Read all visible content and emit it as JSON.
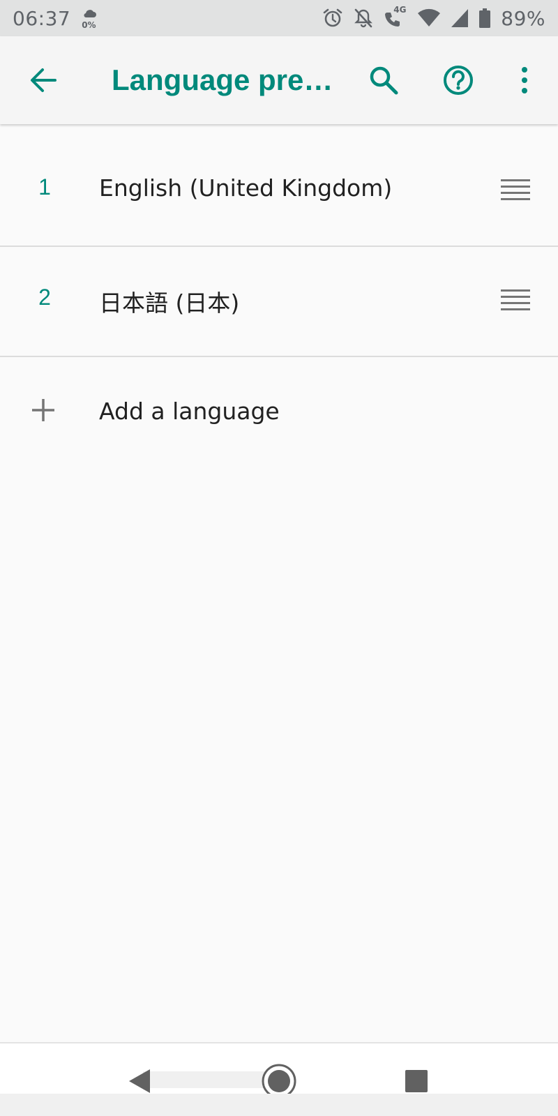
{
  "status_bar": {
    "time": "06:37",
    "weather_percent": "0%",
    "battery_percent": "89%",
    "icons": [
      "cloud-icon",
      "alarm-icon",
      "notifications-off-icon",
      "volte-call-icon",
      "wifi-icon",
      "cellular-signal-icon",
      "battery-icon"
    ],
    "network_label": "4G"
  },
  "app_bar": {
    "title": "Language pref...",
    "icons": [
      "back-arrow-icon",
      "search-icon",
      "help-icon",
      "more-vert-icon"
    ]
  },
  "languages": [
    {
      "index": "1",
      "label": "English (United Kingdom)"
    },
    {
      "index": "2",
      "label": "日本語 (日本)"
    }
  ],
  "add_language": {
    "label": "Add a language"
  },
  "nav_bar": {
    "icons": [
      "nav-back-icon",
      "nav-home-icon",
      "nav-recents-icon"
    ]
  },
  "colors": {
    "accent": "#00897b",
    "status_bar_bg": "#e1e2e2",
    "app_bar_bg": "#f5f5f5",
    "background": "#fafafa",
    "text_primary": "#212121",
    "icon_grey": "#757575"
  }
}
